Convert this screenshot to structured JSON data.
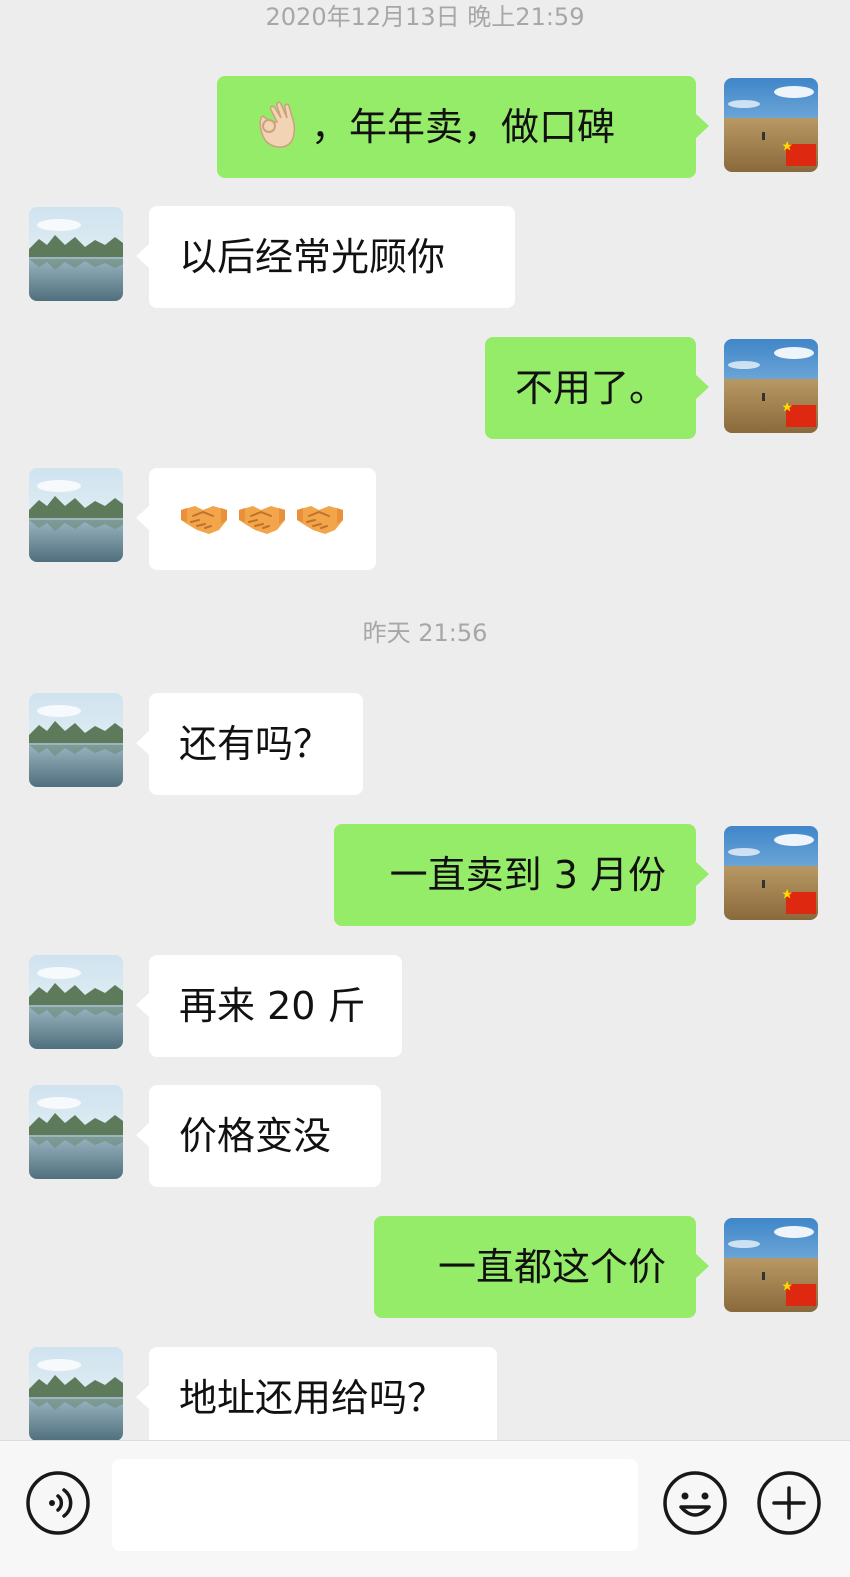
{
  "timestamps": [
    "2020年12月13日 晚上21:59",
    "昨天 21:56"
  ],
  "messages": [
    {
      "side": "out",
      "text": "，年年卖，做口碑",
      "emoji": "ok-hand"
    },
    {
      "side": "in",
      "text": "以后经常光顾你"
    },
    {
      "side": "out",
      "text": "不用了。"
    },
    {
      "side": "in",
      "emoji": "handshake x3"
    },
    {
      "side": "in",
      "text": "还有吗？"
    },
    {
      "side": "out",
      "text": "一直卖到 3 月份"
    },
    {
      "side": "in",
      "text": "再来 20 斤"
    },
    {
      "side": "in",
      "text": "价格变没"
    },
    {
      "side": "out",
      "text": "一直都这个价"
    },
    {
      "side": "in",
      "text": "地址还用给吗？"
    }
  ],
  "avatars": {
    "incoming": "lake-landscape",
    "outgoing": "grassland-with-china-flag"
  },
  "input_bar": {
    "value": "",
    "icons": [
      "voice-icon",
      "emoji-icon",
      "plus-icon"
    ]
  },
  "colors": {
    "background": "#ededed",
    "outgoing_bubble": "#95ec69",
    "incoming_bubble": "#ffffff"
  }
}
